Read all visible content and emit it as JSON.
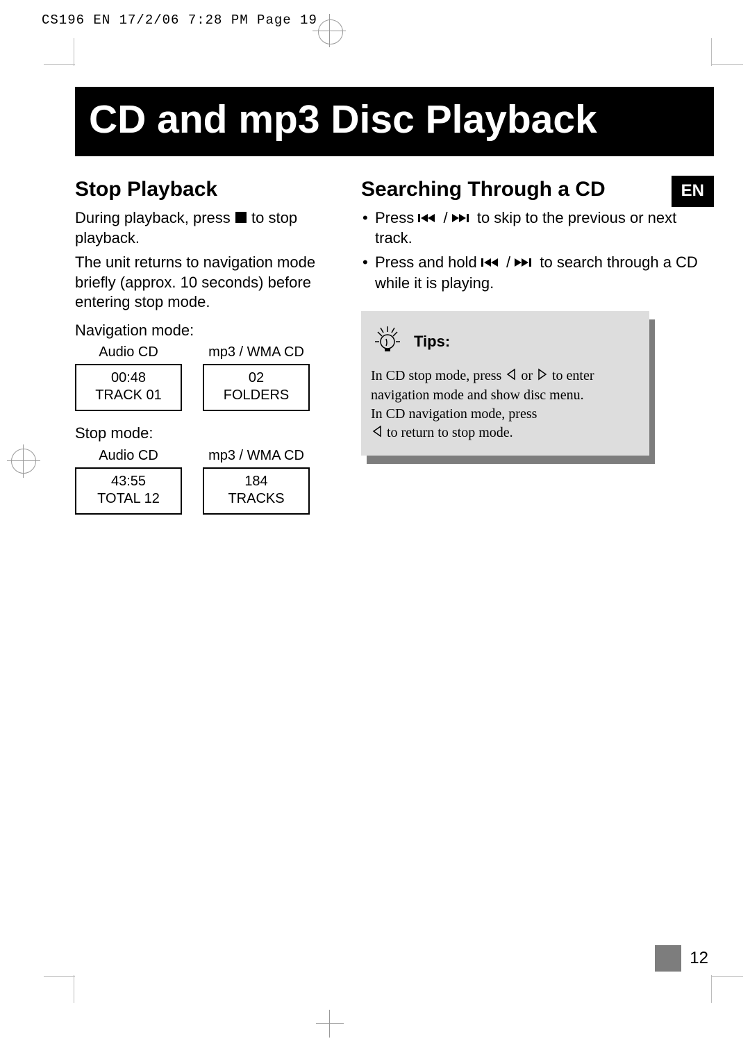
{
  "meta": {
    "printers_line": "CS196 EN  17/2/06  7:28 PM  Page 19"
  },
  "title": "CD and mp3 Disc Playback",
  "lang_tag": "EN",
  "left": {
    "heading": "Stop Playback",
    "para1a": "During playback, press",
    "para1b": "to stop playback.",
    "para2": "The unit returns to navigation mode briefly (approx. 10 seconds) before entering stop mode.",
    "nav_mode_label": "Navigation mode:",
    "stop_mode_label": "Stop mode:",
    "nav_displays": [
      {
        "caption": "Audio CD",
        "line1": "00:48",
        "line2": "TRACK 01"
      },
      {
        "caption": "mp3 / WMA CD",
        "line1": "02",
        "line2": "FOLDERS"
      }
    ],
    "stop_displays": [
      {
        "caption": "Audio CD",
        "line1": "43:55",
        "line2": "TOTAL 12"
      },
      {
        "caption": "mp3 / WMA CD",
        "line1": "184",
        "line2": "TRACKS"
      }
    ]
  },
  "right": {
    "heading": "Searching Through a CD",
    "bullet1a": "Press",
    "bullet1b": "to skip to the previous or next track.",
    "bullet2a": "Press and hold",
    "bullet2b": "to search through a CD while it is playing.",
    "tips_label": "Tips:",
    "tips_line1a": "In CD stop mode, press",
    "tips_line1b": "or",
    "tips_line1c": "to enter navigation mode and show disc menu.",
    "tips_line2a": "In CD navigation mode, press",
    "tips_line2b": "to return to stop mode."
  },
  "page_number": "12"
}
